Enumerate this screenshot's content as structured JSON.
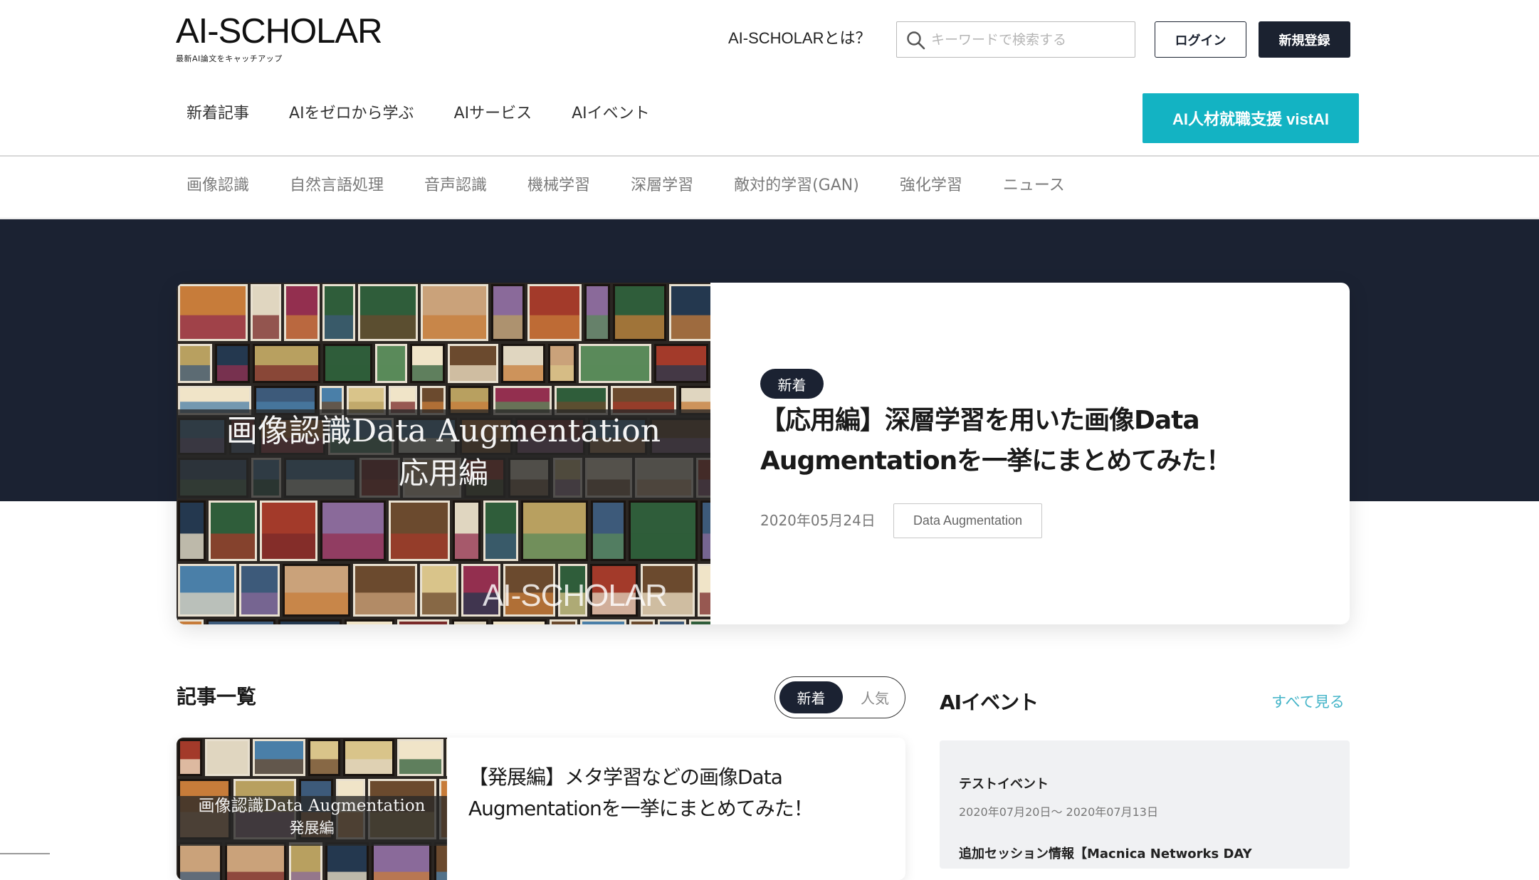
{
  "header": {
    "logo_title": "AI-SCHOLAR",
    "logo_subtitle": "最新AI論文をキャッチアップ",
    "about_link": "AI-SCHOLARとは？",
    "search": {
      "placeholder": "キーワードで検索する",
      "value": ""
    },
    "login_label": "ログイン",
    "register_label": "新規登録"
  },
  "main_nav": {
    "items": [
      "新着記事",
      "AIをゼロから学ぶ",
      "AIサービス",
      "AIイベント"
    ],
    "cta_label": "AI人材就職支援 vistAI"
  },
  "category_nav": {
    "items": [
      "画像認識",
      "自然言語処理",
      "音声認識",
      "機械学習",
      "深層学習",
      "敵対的学習(GAN)",
      "強化学習",
      "ニュース"
    ]
  },
  "hero": {
    "image_title": "画像認識Data Augmentation",
    "image_subtitle": "応用編",
    "image_watermark": "AI-SCHOLAR",
    "badge": "新着",
    "title": "【応用編】深層学習を用いた画像Data Augmentationを一挙にまとめてみた！",
    "date": "2020年05月24日",
    "tag": "Data Augmentation"
  },
  "articles": {
    "section_title": "記事一覧",
    "toggle": {
      "new_label": "新着",
      "popular_label": "人気",
      "selected": "新着"
    },
    "items": [
      {
        "thumb_title": "画像認識Data Augmentation",
        "thumb_subtitle": "発展編",
        "title": "【発展編】メタ学習などの画像Data Augmentationを一挙にまとめてみた！"
      }
    ]
  },
  "events": {
    "title": "AIイベント",
    "see_all_label": "すべて見る",
    "items": [
      {
        "title": "テストイベント",
        "date": "2020年07月20日～ 2020年07月13日"
      },
      {
        "title": "追加セッション情報【Macnica Networks DAY"
      }
    ]
  },
  "colors": {
    "navy": "#1b2232",
    "accent_teal": "#13b3c3",
    "link_blue": "#44b4c8"
  }
}
